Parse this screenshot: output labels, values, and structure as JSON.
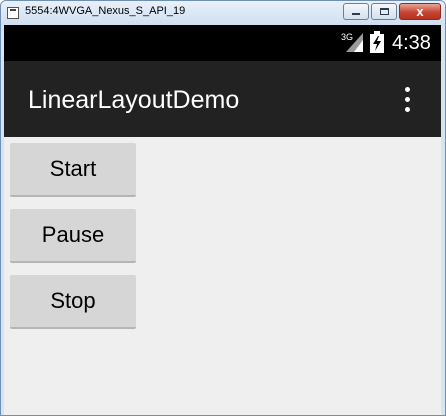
{
  "window": {
    "title": "5554:4WVGA_Nexus_S_API_19",
    "close_glyph": "x"
  },
  "status_bar": {
    "network_type": "3G",
    "time": "4:38"
  },
  "action_bar": {
    "title": "LinearLayoutDemo"
  },
  "buttons": [
    {
      "label": "Start"
    },
    {
      "label": "Pause"
    },
    {
      "label": "Stop"
    }
  ],
  "colors": {
    "status_bar": "#000000",
    "action_bar": "#222222",
    "content_background": "#efefef",
    "button": "#d6d6d6"
  }
}
